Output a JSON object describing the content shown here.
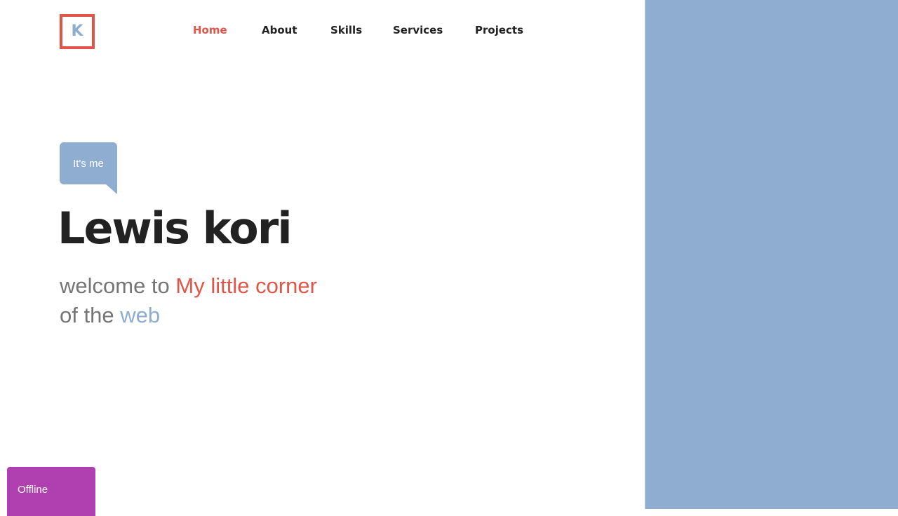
{
  "logo": {
    "letter": "K"
  },
  "nav": {
    "items": [
      {
        "label": "Home",
        "active": true
      },
      {
        "label": "About",
        "active": false
      },
      {
        "label": "Skills",
        "active": false
      },
      {
        "label": "Services",
        "active": false
      },
      {
        "label": "Projects",
        "active": false
      }
    ]
  },
  "hero": {
    "bubble_text": "It's me",
    "name": "Lewis kori",
    "tagline": {
      "part1": "welcome to ",
      "highlight1": "My little corner",
      "part2": "of the ",
      "highlight2": "web"
    }
  },
  "status": {
    "label": "Offline"
  },
  "colors": {
    "accent_red": "#e05548",
    "accent_blue": "#8fadd1",
    "status_purple": "#b03fb0",
    "text_dark": "#222222",
    "text_gray": "#757575"
  }
}
